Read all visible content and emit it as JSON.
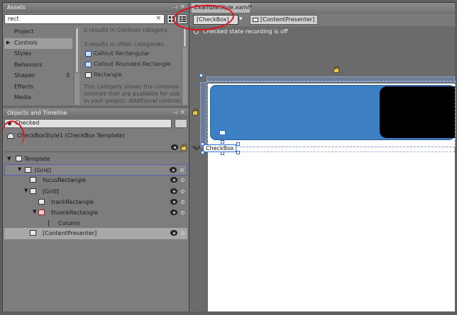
{
  "assets": {
    "title": "Assets",
    "search_value": "rect",
    "categories": [
      {
        "label": "Project",
        "selected": false,
        "arrow": "",
        "count": ""
      },
      {
        "label": "Controls",
        "selected": true,
        "arrow": "▶",
        "count": ""
      },
      {
        "label": "Styles",
        "selected": false,
        "arrow": "",
        "count": ""
      },
      {
        "label": "Behaviors",
        "selected": false,
        "arrow": "",
        "count": ""
      },
      {
        "label": "Shapes",
        "selected": false,
        "arrow": "",
        "count": "3"
      },
      {
        "label": "Effects",
        "selected": false,
        "arrow": "",
        "count": ""
      },
      {
        "label": "Media",
        "selected": false,
        "arrow": "",
        "count": ""
      }
    ],
    "results_in_category": "0 results in Controls category.",
    "results_other": "3 results in other categories.",
    "results": [
      "Callout Rectangular",
      "Callout Rounded Rectangle",
      "Rectangle"
    ],
    "description": "This category shows the common controls that are available for use in your project. Additional controls can"
  },
  "objects": {
    "title": "Objects and Timeline",
    "state": "Checked",
    "style_template": "CheckBoxStyle1 (CheckBox Template)",
    "tree": [
      {
        "label": "Template",
        "indent": 0,
        "expander": "▼",
        "eye": false,
        "style": ""
      },
      {
        "label": "[Grid]",
        "indent": 1,
        "expander": "▼",
        "eye": true,
        "style": "hl"
      },
      {
        "label": "focusRectangle",
        "indent": 2,
        "expander": "",
        "eye": true,
        "style": ""
      },
      {
        "label": "[Grid]",
        "indent": 2,
        "expander": "▼",
        "eye": true,
        "style": ""
      },
      {
        "label": "trackRectangle",
        "indent": 3,
        "expander": "",
        "eye": true,
        "style": ""
      },
      {
        "label": "thumbRectangle",
        "indent": 3,
        "expander": "▼",
        "eye": true,
        "style": ""
      },
      {
        "label": "Column",
        "indent": 4,
        "expander": "",
        "eye": false,
        "style": ""
      },
      {
        "label": "[ContentPresenter]",
        "indent": 2,
        "expander": "",
        "eye": true,
        "style": "sel"
      }
    ]
  },
  "document": {
    "tab_label": "ExampleStyle.xaml*",
    "breadcrumb_template": "[CheckBox]",
    "breadcrumb_part": "[ContentPresenter]",
    "recording_status": "Checked state recording is off",
    "control_label": "CheckBox"
  },
  "colors": {
    "callout": "#e0101a",
    "switch_blue": "#3c7fc2",
    "selection": "#2e6ed8"
  }
}
